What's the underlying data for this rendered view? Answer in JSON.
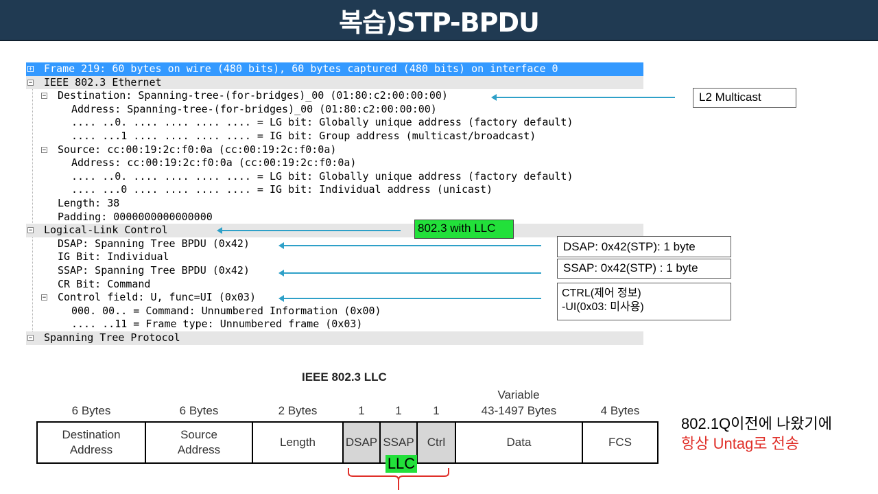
{
  "title": "복습)STP-BPDU",
  "tree": {
    "rows": [
      {
        "indent": 0,
        "toggle": "+",
        "text": "Frame 219: 60 bytes on wire (480 bits), 60 bytes captured (480 bits) on interface 0",
        "style": "sel"
      },
      {
        "indent": 0,
        "toggle": "−",
        "text": "IEEE 802.3 Ethernet",
        "style": "hdr"
      },
      {
        "indent": 1,
        "toggle": "−",
        "text": "Destination: Spanning-tree-(for-bridges)_00 (01:80:c2:00:00:00)",
        "style": ""
      },
      {
        "indent": 2,
        "toggle": "",
        "text": "Address: Spanning-tree-(for-bridges)_00 (01:80:c2:00:00:00)",
        "style": ""
      },
      {
        "indent": 2,
        "toggle": "",
        "text": ".... ..0. .... .... .... .... = LG bit: Globally unique address (factory default)",
        "style": ""
      },
      {
        "indent": 2,
        "toggle": "",
        "text": ".... ...1 .... .... .... .... = IG bit: Group address (multicast/broadcast)",
        "style": ""
      },
      {
        "indent": 1,
        "toggle": "−",
        "text": "Source: cc:00:19:2c:f0:0a (cc:00:19:2c:f0:0a)",
        "style": ""
      },
      {
        "indent": 2,
        "toggle": "",
        "text": "Address: cc:00:19:2c:f0:0a (cc:00:19:2c:f0:0a)",
        "style": ""
      },
      {
        "indent": 2,
        "toggle": "",
        "text": ".... ..0. .... .... .... .... = LG bit: Globally unique address (factory default)",
        "style": ""
      },
      {
        "indent": 2,
        "toggle": "",
        "text": ".... ...0 .... .... .... .... = IG bit: Individual address (unicast)",
        "style": ""
      },
      {
        "indent": 1,
        "toggle": "",
        "text": "Length: 38",
        "style": ""
      },
      {
        "indent": 1,
        "toggle": "",
        "text": "Padding: 0000000000000000",
        "style": ""
      },
      {
        "indent": 0,
        "toggle": "−",
        "text": "Logical-Link Control",
        "style": "hdr"
      },
      {
        "indent": 1,
        "toggle": "",
        "text": "DSAP: Spanning Tree BPDU (0x42)",
        "style": ""
      },
      {
        "indent": 1,
        "toggle": "",
        "text": "IG Bit: Individual",
        "style": ""
      },
      {
        "indent": 1,
        "toggle": "",
        "text": "SSAP: Spanning Tree BPDU (0x42)",
        "style": ""
      },
      {
        "indent": 1,
        "toggle": "",
        "text": "CR Bit: Command",
        "style": ""
      },
      {
        "indent": 1,
        "toggle": "−",
        "text": "Control field: U, func=UI (0x03)",
        "style": ""
      },
      {
        "indent": 2,
        "toggle": "",
        "text": "000. 00.. = Command: Unnumbered Information (0x00)",
        "style": ""
      },
      {
        "indent": 2,
        "toggle": "",
        "text": ".... ..11 = Frame type: Unnumbered frame (0x03)",
        "style": ""
      },
      {
        "indent": 0,
        "toggle": "−",
        "text": "Spanning Tree Protocol",
        "style": "hdr"
      }
    ]
  },
  "callouts": {
    "l2_multicast": "L2 Multicast",
    "llc": "802.3 with LLC",
    "dsap": "DSAP: 0x42(STP): 1 byte",
    "ssap": "SSAP: 0x42(STP) : 1 byte",
    "ctrl_line1": "CTRL(제어 정보)",
    "ctrl_line2": "-UI(0x03: 미사용)"
  },
  "frame": {
    "title": "IEEE 802.3 LLC",
    "variable_label": "Variable",
    "sizes": [
      "6 Bytes",
      "6 Bytes",
      "2 Bytes",
      "1",
      "1",
      "1",
      "43-1497 Bytes",
      "4 Bytes"
    ],
    "fields": [
      {
        "line1": "Destination",
        "line2": "Address"
      },
      {
        "line1": "Source",
        "line2": "Address"
      },
      {
        "line1": "Length",
        "line2": ""
      },
      {
        "line1": "DSAP",
        "line2": ""
      },
      {
        "line1": "SSAP",
        "line2": ""
      },
      {
        "line1": "Ctrl",
        "line2": ""
      },
      {
        "line1": "Data",
        "line2": ""
      },
      {
        "line1": "FCS",
        "line2": ""
      }
    ],
    "llc_label": "LLC"
  },
  "note": {
    "line1": "802.1Q이전에 나왔기에",
    "line2": "항상 Untag로 전송"
  },
  "colors": {
    "title_bg": "#203a52",
    "selection": "#3399ff",
    "highlight_green": "#22e03a",
    "arrow": "#2ea0c8",
    "note_red": "#e0302a"
  }
}
